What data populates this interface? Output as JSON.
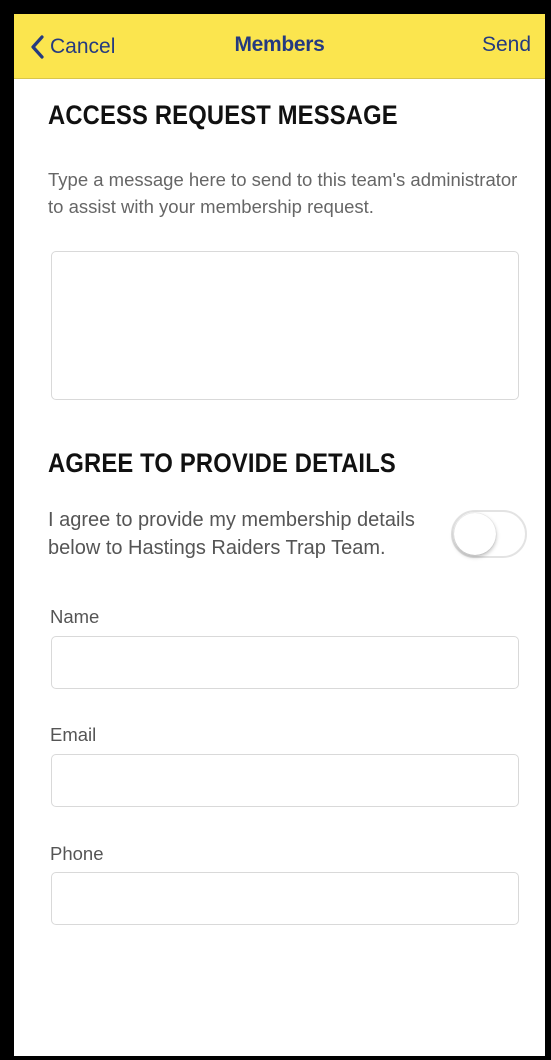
{
  "navbar": {
    "back_label": "Cancel",
    "title": "Members",
    "send_label": "Send",
    "accent_color": "#fbe54e",
    "text_color": "#243a80"
  },
  "access_request": {
    "heading": "ACCESS REQUEST MESSAGE",
    "help_text": "Type a message here to send to this team's administrator to assist with your membership request.",
    "message_value": ""
  },
  "agree": {
    "heading": "AGREE TO PROVIDE DETAILS",
    "text": "I agree to provide my membership details below to Hastings Raiders Trap Team.",
    "toggle_on": false
  },
  "fields": {
    "name_label": "Name",
    "name_value": "",
    "email_label": "Email",
    "email_value": "",
    "phone_label": "Phone",
    "phone_value": ""
  }
}
